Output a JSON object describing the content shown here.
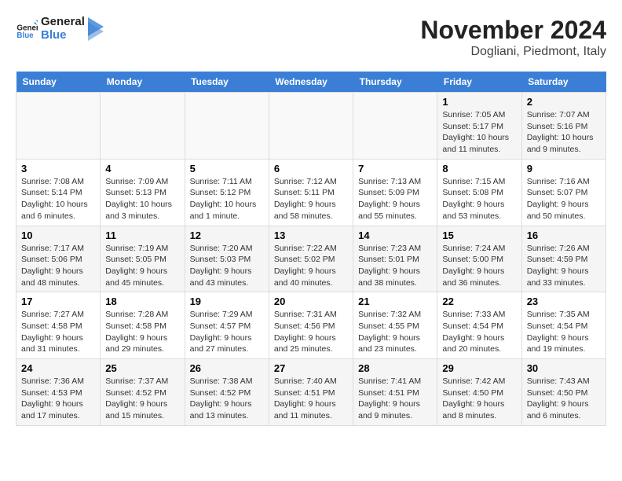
{
  "header": {
    "logo_line1": "General",
    "logo_line2": "Blue",
    "month": "November 2024",
    "location": "Dogliani, Piedmont, Italy"
  },
  "weekdays": [
    "Sunday",
    "Monday",
    "Tuesday",
    "Wednesday",
    "Thursday",
    "Friday",
    "Saturday"
  ],
  "weeks": [
    [
      {
        "day": "",
        "info": ""
      },
      {
        "day": "",
        "info": ""
      },
      {
        "day": "",
        "info": ""
      },
      {
        "day": "",
        "info": ""
      },
      {
        "day": "",
        "info": ""
      },
      {
        "day": "1",
        "info": "Sunrise: 7:05 AM\nSunset: 5:17 PM\nDaylight: 10 hours and 11 minutes."
      },
      {
        "day": "2",
        "info": "Sunrise: 7:07 AM\nSunset: 5:16 PM\nDaylight: 10 hours and 9 minutes."
      }
    ],
    [
      {
        "day": "3",
        "info": "Sunrise: 7:08 AM\nSunset: 5:14 PM\nDaylight: 10 hours and 6 minutes."
      },
      {
        "day": "4",
        "info": "Sunrise: 7:09 AM\nSunset: 5:13 PM\nDaylight: 10 hours and 3 minutes."
      },
      {
        "day": "5",
        "info": "Sunrise: 7:11 AM\nSunset: 5:12 PM\nDaylight: 10 hours and 1 minute."
      },
      {
        "day": "6",
        "info": "Sunrise: 7:12 AM\nSunset: 5:11 PM\nDaylight: 9 hours and 58 minutes."
      },
      {
        "day": "7",
        "info": "Sunrise: 7:13 AM\nSunset: 5:09 PM\nDaylight: 9 hours and 55 minutes."
      },
      {
        "day": "8",
        "info": "Sunrise: 7:15 AM\nSunset: 5:08 PM\nDaylight: 9 hours and 53 minutes."
      },
      {
        "day": "9",
        "info": "Sunrise: 7:16 AM\nSunset: 5:07 PM\nDaylight: 9 hours and 50 minutes."
      }
    ],
    [
      {
        "day": "10",
        "info": "Sunrise: 7:17 AM\nSunset: 5:06 PM\nDaylight: 9 hours and 48 minutes."
      },
      {
        "day": "11",
        "info": "Sunrise: 7:19 AM\nSunset: 5:05 PM\nDaylight: 9 hours and 45 minutes."
      },
      {
        "day": "12",
        "info": "Sunrise: 7:20 AM\nSunset: 5:03 PM\nDaylight: 9 hours and 43 minutes."
      },
      {
        "day": "13",
        "info": "Sunrise: 7:22 AM\nSunset: 5:02 PM\nDaylight: 9 hours and 40 minutes."
      },
      {
        "day": "14",
        "info": "Sunrise: 7:23 AM\nSunset: 5:01 PM\nDaylight: 9 hours and 38 minutes."
      },
      {
        "day": "15",
        "info": "Sunrise: 7:24 AM\nSunset: 5:00 PM\nDaylight: 9 hours and 36 minutes."
      },
      {
        "day": "16",
        "info": "Sunrise: 7:26 AM\nSunset: 4:59 PM\nDaylight: 9 hours and 33 minutes."
      }
    ],
    [
      {
        "day": "17",
        "info": "Sunrise: 7:27 AM\nSunset: 4:58 PM\nDaylight: 9 hours and 31 minutes."
      },
      {
        "day": "18",
        "info": "Sunrise: 7:28 AM\nSunset: 4:58 PM\nDaylight: 9 hours and 29 minutes."
      },
      {
        "day": "19",
        "info": "Sunrise: 7:29 AM\nSunset: 4:57 PM\nDaylight: 9 hours and 27 minutes."
      },
      {
        "day": "20",
        "info": "Sunrise: 7:31 AM\nSunset: 4:56 PM\nDaylight: 9 hours and 25 minutes."
      },
      {
        "day": "21",
        "info": "Sunrise: 7:32 AM\nSunset: 4:55 PM\nDaylight: 9 hours and 23 minutes."
      },
      {
        "day": "22",
        "info": "Sunrise: 7:33 AM\nSunset: 4:54 PM\nDaylight: 9 hours and 20 minutes."
      },
      {
        "day": "23",
        "info": "Sunrise: 7:35 AM\nSunset: 4:54 PM\nDaylight: 9 hours and 19 minutes."
      }
    ],
    [
      {
        "day": "24",
        "info": "Sunrise: 7:36 AM\nSunset: 4:53 PM\nDaylight: 9 hours and 17 minutes."
      },
      {
        "day": "25",
        "info": "Sunrise: 7:37 AM\nSunset: 4:52 PM\nDaylight: 9 hours and 15 minutes."
      },
      {
        "day": "26",
        "info": "Sunrise: 7:38 AM\nSunset: 4:52 PM\nDaylight: 9 hours and 13 minutes."
      },
      {
        "day": "27",
        "info": "Sunrise: 7:40 AM\nSunset: 4:51 PM\nDaylight: 9 hours and 11 minutes."
      },
      {
        "day": "28",
        "info": "Sunrise: 7:41 AM\nSunset: 4:51 PM\nDaylight: 9 hours and 9 minutes."
      },
      {
        "day": "29",
        "info": "Sunrise: 7:42 AM\nSunset: 4:50 PM\nDaylight: 9 hours and 8 minutes."
      },
      {
        "day": "30",
        "info": "Sunrise: 7:43 AM\nSunset: 4:50 PM\nDaylight: 9 hours and 6 minutes."
      }
    ]
  ]
}
